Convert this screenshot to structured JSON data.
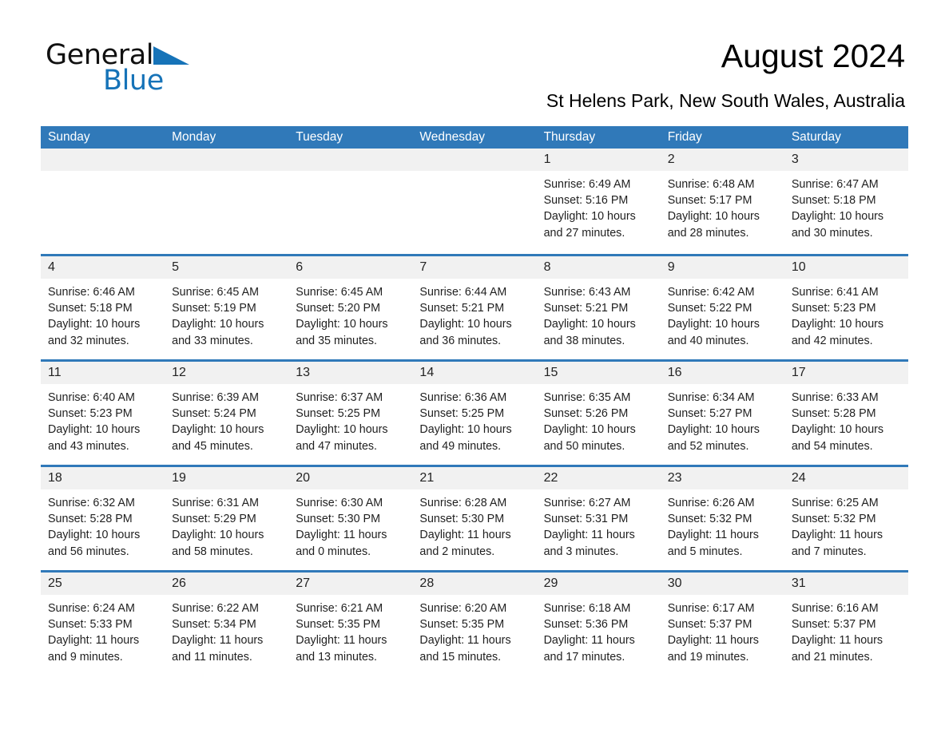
{
  "brand": {
    "logo_line1": "General",
    "logo_line2": "Blue",
    "triangle_icon": "triangle-icon",
    "black": "#111111",
    "blue": "#1673b8"
  },
  "header": {
    "title": "August 2024",
    "subtitle": "St Helens Park, New South Wales, Australia"
  },
  "theme": {
    "header_blue": "#3079b9",
    "day_band_gray": "#f1f1f1",
    "text": "#1f1f1f"
  },
  "calendar": {
    "weekdays": [
      "Sunday",
      "Monday",
      "Tuesday",
      "Wednesday",
      "Thursday",
      "Friday",
      "Saturday"
    ],
    "weeks": [
      [
        {
          "day": "",
          "sunrise": "",
          "sunset": "",
          "daylight": ""
        },
        {
          "day": "",
          "sunrise": "",
          "sunset": "",
          "daylight": ""
        },
        {
          "day": "",
          "sunrise": "",
          "sunset": "",
          "daylight": ""
        },
        {
          "day": "",
          "sunrise": "",
          "sunset": "",
          "daylight": ""
        },
        {
          "day": "1",
          "sunrise": "Sunrise: 6:49 AM",
          "sunset": "Sunset: 5:16 PM",
          "daylight": "Daylight: 10 hours and 27 minutes."
        },
        {
          "day": "2",
          "sunrise": "Sunrise: 6:48 AM",
          "sunset": "Sunset: 5:17 PM",
          "daylight": "Daylight: 10 hours and 28 minutes."
        },
        {
          "day": "3",
          "sunrise": "Sunrise: 6:47 AM",
          "sunset": "Sunset: 5:18 PM",
          "daylight": "Daylight: 10 hours and 30 minutes."
        }
      ],
      [
        {
          "day": "4",
          "sunrise": "Sunrise: 6:46 AM",
          "sunset": "Sunset: 5:18 PM",
          "daylight": "Daylight: 10 hours and 32 minutes."
        },
        {
          "day": "5",
          "sunrise": "Sunrise: 6:45 AM",
          "sunset": "Sunset: 5:19 PM",
          "daylight": "Daylight: 10 hours and 33 minutes."
        },
        {
          "day": "6",
          "sunrise": "Sunrise: 6:45 AM",
          "sunset": "Sunset: 5:20 PM",
          "daylight": "Daylight: 10 hours and 35 minutes."
        },
        {
          "day": "7",
          "sunrise": "Sunrise: 6:44 AM",
          "sunset": "Sunset: 5:21 PM",
          "daylight": "Daylight: 10 hours and 36 minutes."
        },
        {
          "day": "8",
          "sunrise": "Sunrise: 6:43 AM",
          "sunset": "Sunset: 5:21 PM",
          "daylight": "Daylight: 10 hours and 38 minutes."
        },
        {
          "day": "9",
          "sunrise": "Sunrise: 6:42 AM",
          "sunset": "Sunset: 5:22 PM",
          "daylight": "Daylight: 10 hours and 40 minutes."
        },
        {
          "day": "10",
          "sunrise": "Sunrise: 6:41 AM",
          "sunset": "Sunset: 5:23 PM",
          "daylight": "Daylight: 10 hours and 42 minutes."
        }
      ],
      [
        {
          "day": "11",
          "sunrise": "Sunrise: 6:40 AM",
          "sunset": "Sunset: 5:23 PM",
          "daylight": "Daylight: 10 hours and 43 minutes."
        },
        {
          "day": "12",
          "sunrise": "Sunrise: 6:39 AM",
          "sunset": "Sunset: 5:24 PM",
          "daylight": "Daylight: 10 hours and 45 minutes."
        },
        {
          "day": "13",
          "sunrise": "Sunrise: 6:37 AM",
          "sunset": "Sunset: 5:25 PM",
          "daylight": "Daylight: 10 hours and 47 minutes."
        },
        {
          "day": "14",
          "sunrise": "Sunrise: 6:36 AM",
          "sunset": "Sunset: 5:25 PM",
          "daylight": "Daylight: 10 hours and 49 minutes."
        },
        {
          "day": "15",
          "sunrise": "Sunrise: 6:35 AM",
          "sunset": "Sunset: 5:26 PM",
          "daylight": "Daylight: 10 hours and 50 minutes."
        },
        {
          "day": "16",
          "sunrise": "Sunrise: 6:34 AM",
          "sunset": "Sunset: 5:27 PM",
          "daylight": "Daylight: 10 hours and 52 minutes."
        },
        {
          "day": "17",
          "sunrise": "Sunrise: 6:33 AM",
          "sunset": "Sunset: 5:28 PM",
          "daylight": "Daylight: 10 hours and 54 minutes."
        }
      ],
      [
        {
          "day": "18",
          "sunrise": "Sunrise: 6:32 AM",
          "sunset": "Sunset: 5:28 PM",
          "daylight": "Daylight: 10 hours and 56 minutes."
        },
        {
          "day": "19",
          "sunrise": "Sunrise: 6:31 AM",
          "sunset": "Sunset: 5:29 PM",
          "daylight": "Daylight: 10 hours and 58 minutes."
        },
        {
          "day": "20",
          "sunrise": "Sunrise: 6:30 AM",
          "sunset": "Sunset: 5:30 PM",
          "daylight": "Daylight: 11 hours and 0 minutes."
        },
        {
          "day": "21",
          "sunrise": "Sunrise: 6:28 AM",
          "sunset": "Sunset: 5:30 PM",
          "daylight": "Daylight: 11 hours and 2 minutes."
        },
        {
          "day": "22",
          "sunrise": "Sunrise: 6:27 AM",
          "sunset": "Sunset: 5:31 PM",
          "daylight": "Daylight: 11 hours and 3 minutes."
        },
        {
          "day": "23",
          "sunrise": "Sunrise: 6:26 AM",
          "sunset": "Sunset: 5:32 PM",
          "daylight": "Daylight: 11 hours and 5 minutes."
        },
        {
          "day": "24",
          "sunrise": "Sunrise: 6:25 AM",
          "sunset": "Sunset: 5:32 PM",
          "daylight": "Daylight: 11 hours and 7 minutes."
        }
      ],
      [
        {
          "day": "25",
          "sunrise": "Sunrise: 6:24 AM",
          "sunset": "Sunset: 5:33 PM",
          "daylight": "Daylight: 11 hours and 9 minutes."
        },
        {
          "day": "26",
          "sunrise": "Sunrise: 6:22 AM",
          "sunset": "Sunset: 5:34 PM",
          "daylight": "Daylight: 11 hours and 11 minutes."
        },
        {
          "day": "27",
          "sunrise": "Sunrise: 6:21 AM",
          "sunset": "Sunset: 5:35 PM",
          "daylight": "Daylight: 11 hours and 13 minutes."
        },
        {
          "day": "28",
          "sunrise": "Sunrise: 6:20 AM",
          "sunset": "Sunset: 5:35 PM",
          "daylight": "Daylight: 11 hours and 15 minutes."
        },
        {
          "day": "29",
          "sunrise": "Sunrise: 6:18 AM",
          "sunset": "Sunset: 5:36 PM",
          "daylight": "Daylight: 11 hours and 17 minutes."
        },
        {
          "day": "30",
          "sunrise": "Sunrise: 6:17 AM",
          "sunset": "Sunset: 5:37 PM",
          "daylight": "Daylight: 11 hours and 19 minutes."
        },
        {
          "day": "31",
          "sunrise": "Sunrise: 6:16 AM",
          "sunset": "Sunset: 5:37 PM",
          "daylight": "Daylight: 11 hours and 21 minutes."
        }
      ]
    ]
  }
}
